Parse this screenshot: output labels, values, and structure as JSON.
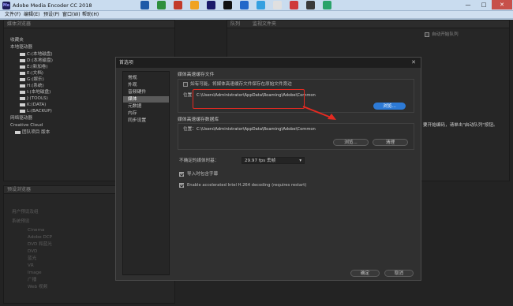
{
  "window": {
    "title": "Adobe Media Encoder CC 2018",
    "app_icon_text": "Me",
    "min": "—",
    "max": "□",
    "close": "✕"
  },
  "menu": [
    "文件(F)",
    "编辑(E)",
    "预设(P)",
    "窗口(W)",
    "帮助(H)"
  ],
  "left_panel": {
    "title": "媒体浏览器",
    "favorites": "收藏夹",
    "local_drives": "本地驱动器",
    "drives": [
      "C:(本地磁盘)",
      "D:(本地磁盘)",
      "E:(新加卷)",
      "E:(文档)",
      "G:(娱乐)",
      "H:(系统)",
      "I:(本地磁盘)",
      "J:(TOOLS)",
      "K:(DATA)",
      "L:(BACKUP)"
    ],
    "network": "网络驱动器",
    "creative_cloud": "Creative Cloud",
    "team_projects": "团队项目 版本"
  },
  "preset_panel": {
    "title": "预设浏览器",
    "user_presets": "用户预设及组",
    "system_presets": "系统预设",
    "items": [
      "Cinema",
      "Adobe DCP",
      "DVD 和蓝光",
      "DVD",
      "蓝光",
      "VR",
      "Image",
      "广播",
      "Web 视频"
    ]
  },
  "queue_panel": {
    "title": "队列",
    "tab2": "监视文件夹",
    "auto_start": "自动开始队列",
    "hint": "要开始编码，请单击\"启动队列\"按钮。"
  },
  "dialog": {
    "title": "首选项",
    "close": "✕",
    "nav": [
      "常规",
      "外观",
      "音频硬件",
      "媒体",
      "元数据",
      "内存",
      "同步设置"
    ],
    "nav_selected": 3,
    "cache_section": "媒体高速缓存文件",
    "cache_checkbox_label": "如有可能，将媒体高速缓存文件保存在原始文件旁边",
    "location_label": "位置：",
    "cache_path": "C:\\Users\\Administrator\\AppData\\Roaming\\Adobe\\Common",
    "browse": "浏览...",
    "db_section": "媒体高速缓存数据库",
    "db_location_label": "位置：",
    "db_path": "C:\\Users\\Administrator\\AppData\\Roaming\\Adobe\\Common",
    "db_browse": "浏览...",
    "clean": "清理",
    "timebase_label": "不确定的媒体时基：",
    "timebase_value": "29.97 fps 丢帧",
    "import_captions": "导入时包含字幕",
    "intel_decode": "Enable accelerated Intel H.264 decoding (requires restart)",
    "ok": "确定",
    "cancel": "取消"
  },
  "colors": {
    "accent_blue": "#2d7ad6",
    "callout_red": "#e52a21",
    "dialog_bg": "#303030"
  }
}
